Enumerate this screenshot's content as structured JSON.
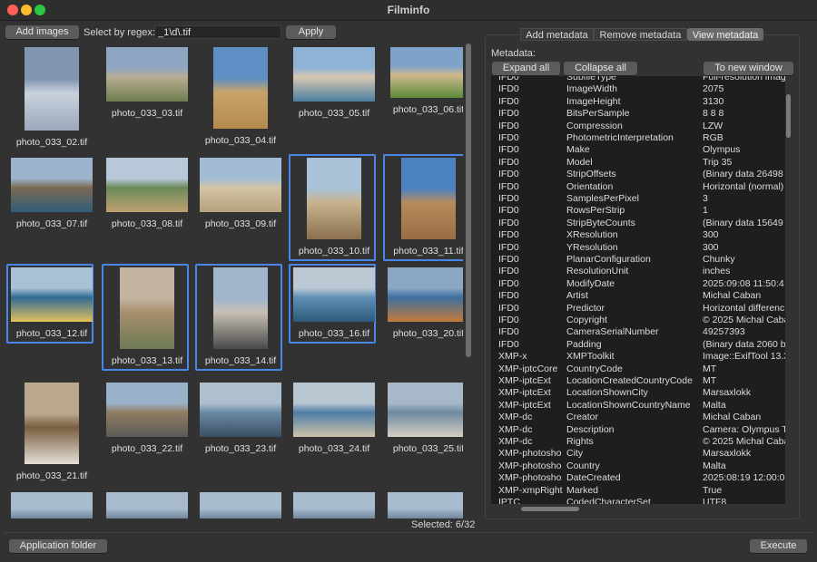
{
  "window": {
    "title": "Filminfo"
  },
  "toolbar": {
    "add_images": "Add images",
    "regex_label": "Select by regex:",
    "regex_value": "_1\\d\\.tif",
    "apply": "Apply"
  },
  "grid": {
    "selected_count": "Selected: 6/32",
    "items": [
      {
        "name": "photo_033_02.tif",
        "selected": false
      },
      {
        "name": "photo_033_03.tif",
        "selected": false
      },
      {
        "name": "photo_033_04.tif",
        "selected": false
      },
      {
        "name": "photo_033_05.tif",
        "selected": false
      },
      {
        "name": "photo_033_06.tif",
        "selected": false
      },
      {
        "name": "photo_033_07.tif",
        "selected": false
      },
      {
        "name": "photo_033_08.tif",
        "selected": false
      },
      {
        "name": "photo_033_09.tif",
        "selected": false
      },
      {
        "name": "photo_033_10.tif",
        "selected": true
      },
      {
        "name": "photo_033_11.tif",
        "selected": true
      },
      {
        "name": "photo_033_12.tif",
        "selected": true
      },
      {
        "name": "photo_033_13.tif",
        "selected": true
      },
      {
        "name": "photo_033_14.tif",
        "selected": true
      },
      {
        "name": "photo_033_16.tif",
        "selected": true
      },
      {
        "name": "photo_033_20.tif",
        "selected": false
      },
      {
        "name": "photo_033_21.tif",
        "selected": false
      },
      {
        "name": "photo_033_22.tif",
        "selected": false
      },
      {
        "name": "photo_033_23.tif",
        "selected": false
      },
      {
        "name": "photo_033_24.tif",
        "selected": false
      },
      {
        "name": "photo_033_25.tif",
        "selected": false
      }
    ]
  },
  "tabs": {
    "add": "Add metadata",
    "remove": "Remove metadata",
    "view": "View metadata"
  },
  "metadata": {
    "label": "Metadata:",
    "expand_all": "Expand all",
    "collapse_all": "Collapse all",
    "new_window": "To new window",
    "rows": [
      [
        "IFD0",
        "SubfileType",
        "Full-resolution imag"
      ],
      [
        "IFD0",
        "ImageWidth",
        "2075"
      ],
      [
        "IFD0",
        "ImageHeight",
        "3130"
      ],
      [
        "IFD0",
        "BitsPerSample",
        "8 8 8"
      ],
      [
        "IFD0",
        "Compression",
        "LZW"
      ],
      [
        "IFD0",
        "PhotometricInterpretation",
        "RGB"
      ],
      [
        "IFD0",
        "Make",
        "Olympus"
      ],
      [
        "IFD0",
        "Model",
        "Trip 35"
      ],
      [
        "IFD0",
        "StripOffsets",
        "(Binary data 26498"
      ],
      [
        "IFD0",
        "Orientation",
        "Horizontal (normal)"
      ],
      [
        "IFD0",
        "SamplesPerPixel",
        "3"
      ],
      [
        "IFD0",
        "RowsPerStrip",
        "1"
      ],
      [
        "IFD0",
        "StripByteCounts",
        "(Binary data 15649"
      ],
      [
        "IFD0",
        "XResolution",
        "300"
      ],
      [
        "IFD0",
        "YResolution",
        "300"
      ],
      [
        "IFD0",
        "PlanarConfiguration",
        "Chunky"
      ],
      [
        "IFD0",
        "ResolutionUnit",
        "inches"
      ],
      [
        "IFD0",
        "ModifyDate",
        "2025:09:08 11:50:4"
      ],
      [
        "IFD0",
        "Artist",
        "Michal Caban"
      ],
      [
        "IFD0",
        "Predictor",
        "Horizontal differenc"
      ],
      [
        "IFD0",
        "Copyright",
        "© 2025 Michal Caba"
      ],
      [
        "IFD0",
        "CameraSerialNumber",
        "49257393"
      ],
      [
        "IFD0",
        "Padding",
        "(Binary data 2060 b"
      ],
      [
        "XMP-x",
        "XMPToolkit",
        "Image::ExifTool 13.3"
      ],
      [
        "XMP-iptcCore",
        "CountryCode",
        "MT"
      ],
      [
        "XMP-iptcExt",
        "LocationCreatedCountryCode",
        "MT"
      ],
      [
        "XMP-iptcExt",
        "LocationShownCity",
        "Marsaxlokk"
      ],
      [
        "XMP-iptcExt",
        "LocationShownCountryName",
        "Malta"
      ],
      [
        "XMP-dc",
        "Creator",
        "Michal Caban"
      ],
      [
        "XMP-dc",
        "Description",
        "Camera: Olympus T"
      ],
      [
        "XMP-dc",
        "Rights",
        "© 2025 Michal Caba"
      ],
      [
        "XMP-photosho",
        "City",
        "Marsaxlokk"
      ],
      [
        "XMP-photosho",
        "Country",
        "Malta"
      ],
      [
        "XMP-photosho",
        "DateCreated",
        "2025:08:19 12:00:0"
      ],
      [
        "XMP-xmpRight",
        "Marked",
        "True"
      ],
      [
        "IPTC",
        "CodedCharacterSet",
        "UTF8"
      ]
    ]
  },
  "footer": {
    "app_folder": "Application folder",
    "execute": "Execute"
  }
}
